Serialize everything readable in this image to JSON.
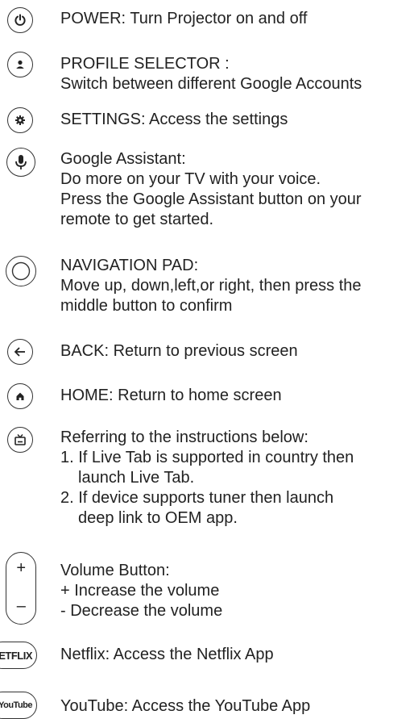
{
  "items": [
    {
      "id": "power",
      "heading": "POWER:",
      "lines": [
        "Turn Projector on and off"
      ],
      "icon": "power-icon"
    },
    {
      "id": "profile",
      "heading": "PROFILE SELECTOR :",
      "lines": [
        "Switch between different Google Accounts"
      ],
      "icon": "person-icon"
    },
    {
      "id": "settings",
      "heading": "SETTINGS:",
      "lines": [
        "Access the settings"
      ],
      "icon": "gear-icon"
    },
    {
      "id": "assistant",
      "heading": "Google Assistant:",
      "lines": [
        "Do more on your TV with your voice.",
        "Press the Google Assistant button on your",
        "remote to get started."
      ],
      "icon": "microphone-icon"
    },
    {
      "id": "navigation",
      "heading": "NAVIGATION PAD:",
      "lines": [
        "Move up, down,left,or right, then press the",
        "middle button to confirm"
      ],
      "icon": "circle-icon"
    },
    {
      "id": "back",
      "heading": "BACK:",
      "lines": [
        "Return to previous screen"
      ],
      "icon": "back-arrow-icon"
    },
    {
      "id": "home",
      "heading": "HOME:",
      "lines": [
        "Return to home screen"
      ],
      "icon": "home-icon"
    },
    {
      "id": "live",
      "heading": "Referring to the instructions below:",
      "lines": [
        "1. If Live Tab is supported in country then",
        "launch Live Tab.",
        "2. If device supports tuner then launch",
        "deep link to OEM app."
      ],
      "icon": "tv-icon"
    },
    {
      "id": "volume",
      "heading": "Volume Button:",
      "lines": [
        "+ Increase the volume",
        "- Decrease the volume"
      ],
      "icon": "volume-rocker-icon",
      "plus": "+",
      "minus": "–"
    },
    {
      "id": "netflix",
      "heading": "Netflix:",
      "lines": [
        "Access the Netflix App"
      ],
      "icon": "netflix-logo-icon",
      "logo": "ETFLIX"
    },
    {
      "id": "youtube",
      "heading": "YouTube:",
      "lines": [
        "Access the YouTube App"
      ],
      "icon": "youtube-logo-icon",
      "logo": "YouTube"
    }
  ]
}
